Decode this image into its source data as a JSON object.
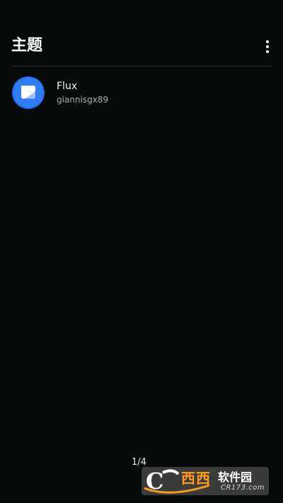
{
  "header": {
    "title": "主题",
    "more_icon": "more-vert-icon"
  },
  "themes": [
    {
      "name": "Flux",
      "author": "giannisgx89",
      "icon": "flux-theme-icon",
      "icon_color": "#1e6ff0"
    }
  ],
  "pagination": {
    "indicator": "1/4"
  },
  "watermark": {
    "brand": "西西",
    "text": "软件园",
    "domain": "CR173.com"
  },
  "colors": {
    "background": "#060b09",
    "accent_blue": "#1e6ff0",
    "watermark_orange": "#ff9a1a"
  }
}
